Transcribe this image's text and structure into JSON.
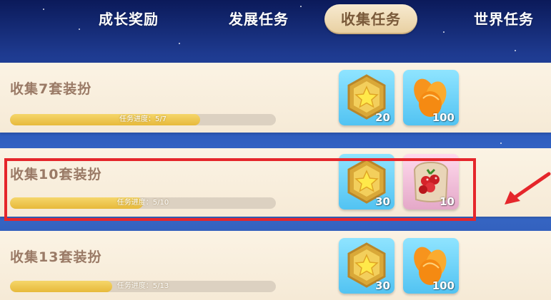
{
  "tabs": [
    {
      "label": "成长奖励",
      "active": false
    },
    {
      "label": "发展任务",
      "active": false
    },
    {
      "label": "收集任务",
      "active": true
    },
    {
      "label": "世界任务",
      "active": false
    }
  ],
  "tasks": [
    {
      "title": "收集7套装扮",
      "progress_text": "任务进度：5/7",
      "progress_fraction": 0.714,
      "rewards": [
        {
          "icon": "star-badge-icon",
          "count": "20",
          "bg": "blue"
        },
        {
          "icon": "orange-slices-icon",
          "count": "100",
          "bg": "blue"
        }
      ]
    },
    {
      "title": "收集10套装扮",
      "progress_text": "任务进度：5/10",
      "progress_fraction": 0.5,
      "highlighted": true,
      "rewards": [
        {
          "icon": "star-badge-icon",
          "count": "30",
          "bg": "blue"
        },
        {
          "icon": "berry-bag-icon",
          "count": "10",
          "bg": "pink"
        }
      ]
    },
    {
      "title": "收集13套装扮",
      "progress_text": "任务进度：5/13",
      "progress_fraction": 0.385,
      "rewards": [
        {
          "icon": "star-badge-icon",
          "count": "30",
          "bg": "blue"
        },
        {
          "icon": "orange-slices-icon",
          "count": "100",
          "bg": "blue"
        }
      ]
    }
  ],
  "colors": {
    "highlight": "#e5262b",
    "tab_active_bg": "#f2e0bd",
    "row_bg": "#fbf3e4",
    "progress_fill": "#e7b93a"
  }
}
